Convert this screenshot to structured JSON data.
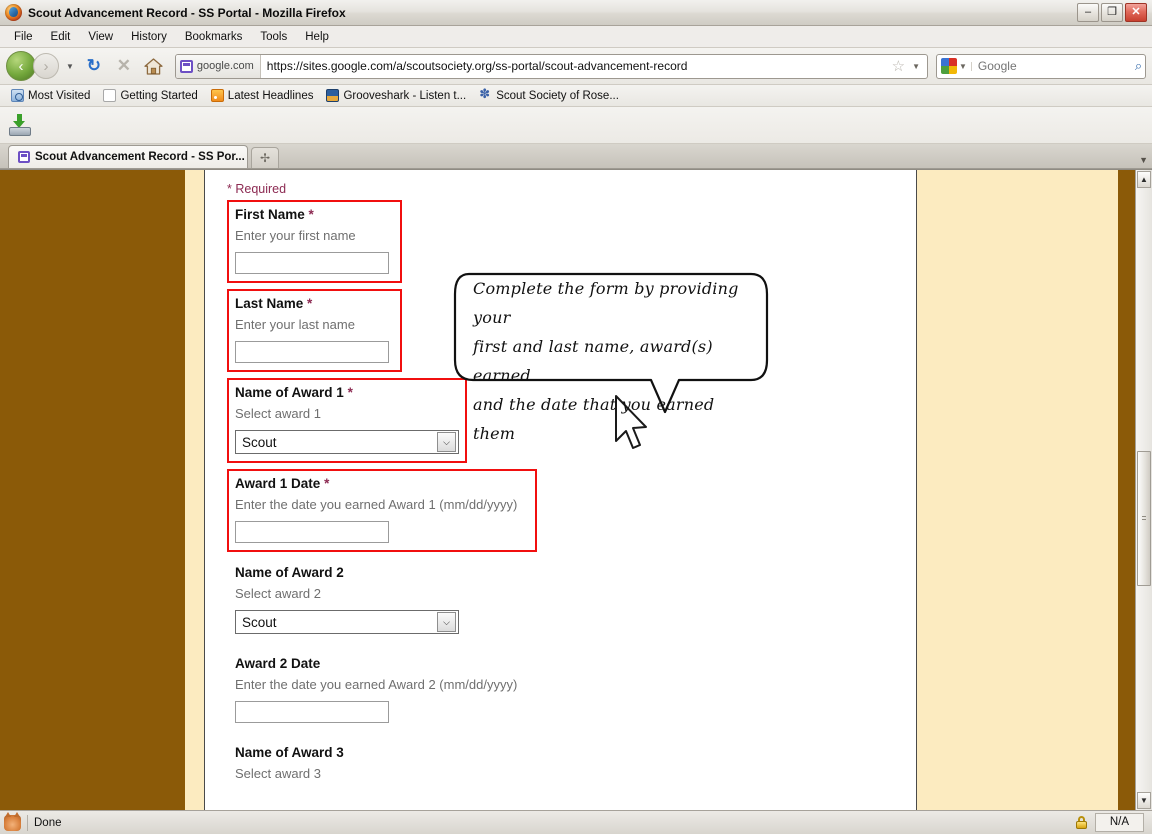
{
  "window": {
    "title": "Scout Advancement Record - SS Portal - Mozilla Firefox",
    "minimize_label": "–",
    "restore_label": "❐",
    "close_label": "✕"
  },
  "menubar": [
    {
      "label": "File"
    },
    {
      "label": "Edit"
    },
    {
      "label": "View"
    },
    {
      "label": "History"
    },
    {
      "label": "Bookmarks"
    },
    {
      "label": "Tools"
    },
    {
      "label": "Help"
    }
  ],
  "toolbar": {
    "back_glyph": "‹",
    "forward_glyph": "›",
    "nav_dropdown_glyph": "▼",
    "reload_glyph": "↻",
    "stop_glyph": "✕",
    "home_label": "Home",
    "site_identity": "google.com",
    "url": "https://sites.google.com/a/scoutsociety.org/ss-portal/scout-advancement-record",
    "bookmark_star_glyph": "☆",
    "url_dropdown_glyph": "▼",
    "search_engine": "Google",
    "search_placeholder": "Google",
    "search_value": "",
    "search_dropdown_glyph": "▼",
    "search_go_glyph": "⌕"
  },
  "bookmarks": [
    {
      "label": "Most Visited",
      "icon": "most-visited-icon"
    },
    {
      "label": "Getting Started",
      "icon": "page-icon"
    },
    {
      "label": "Latest Headlines",
      "icon": "rss-icon"
    },
    {
      "label": "Grooveshark - Listen t...",
      "icon": "grooveshark-icon"
    },
    {
      "label": "Scout Society of Rose...",
      "icon": "scout-society-icon"
    }
  ],
  "toolstrip": {
    "downloads_label": "Downloads"
  },
  "tabs": {
    "items": [
      {
        "label": "Scout Advancement Record - SS Por...",
        "active": true
      }
    ],
    "new_tab_glyph": "✢",
    "list_all_glyph": "▼"
  },
  "page": {
    "required_note": "* Required",
    "fields": [
      {
        "id": "first-name",
        "label": "First Name",
        "required": true,
        "help": "Enter your first name",
        "control": "text",
        "value": "",
        "highlighted": true,
        "width_class": "w-name"
      },
      {
        "id": "last-name",
        "label": "Last Name",
        "required": true,
        "help": "Enter your last name",
        "control": "text",
        "value": "",
        "highlighted": true,
        "width_class": "w-name"
      },
      {
        "id": "award-1-name",
        "label": "Name of Award 1",
        "required": true,
        "help": "Select award 1",
        "control": "select",
        "value": "Scout",
        "highlighted": true,
        "width_class": "w-award"
      },
      {
        "id": "award-1-date",
        "label": "Award 1 Date",
        "required": true,
        "help": "Enter the date you earned Award 1 (mm/dd/yyyy)",
        "control": "text",
        "value": "",
        "highlighted": true,
        "width_class": "w-date"
      },
      {
        "id": "award-2-name",
        "label": "Name of Award 2",
        "required": false,
        "help": "Select award 2",
        "control": "select",
        "value": "Scout",
        "highlighted": false,
        "width_class": "w-award"
      },
      {
        "id": "award-2-date",
        "label": "Award 2 Date",
        "required": false,
        "help": "Enter the date you earned Award 2 (mm/dd/yyyy)",
        "control": "text",
        "value": "",
        "highlighted": false,
        "width_class": "w-date"
      },
      {
        "id": "award-3-name",
        "label": "Name of Award 3",
        "required": false,
        "help": "Select award 3",
        "control": "none",
        "value": "",
        "highlighted": false,
        "width_class": "w-award"
      }
    ],
    "required_marker": "*",
    "select_arrow_glyph": "⌵",
    "annotation": "Complete the form by providing your first and last name, award(s) earned and the date that you earned them",
    "annotation_lines": [
      "Complete the form by providing your",
      "first and last name, award(s) earned",
      "and the date that you earned them"
    ]
  },
  "scrollbar": {
    "up_glyph": "▲",
    "down_glyph": "▼"
  },
  "statusbar": {
    "text": "Done",
    "security_label": "N/A"
  },
  "colors": {
    "sidebar_brown": "#8B5A08",
    "cream": "#FCEBC0",
    "highlight_red": "#F10F0F",
    "required_maroon": "#8C2A52",
    "help_gray": "#6F6F6F"
  }
}
